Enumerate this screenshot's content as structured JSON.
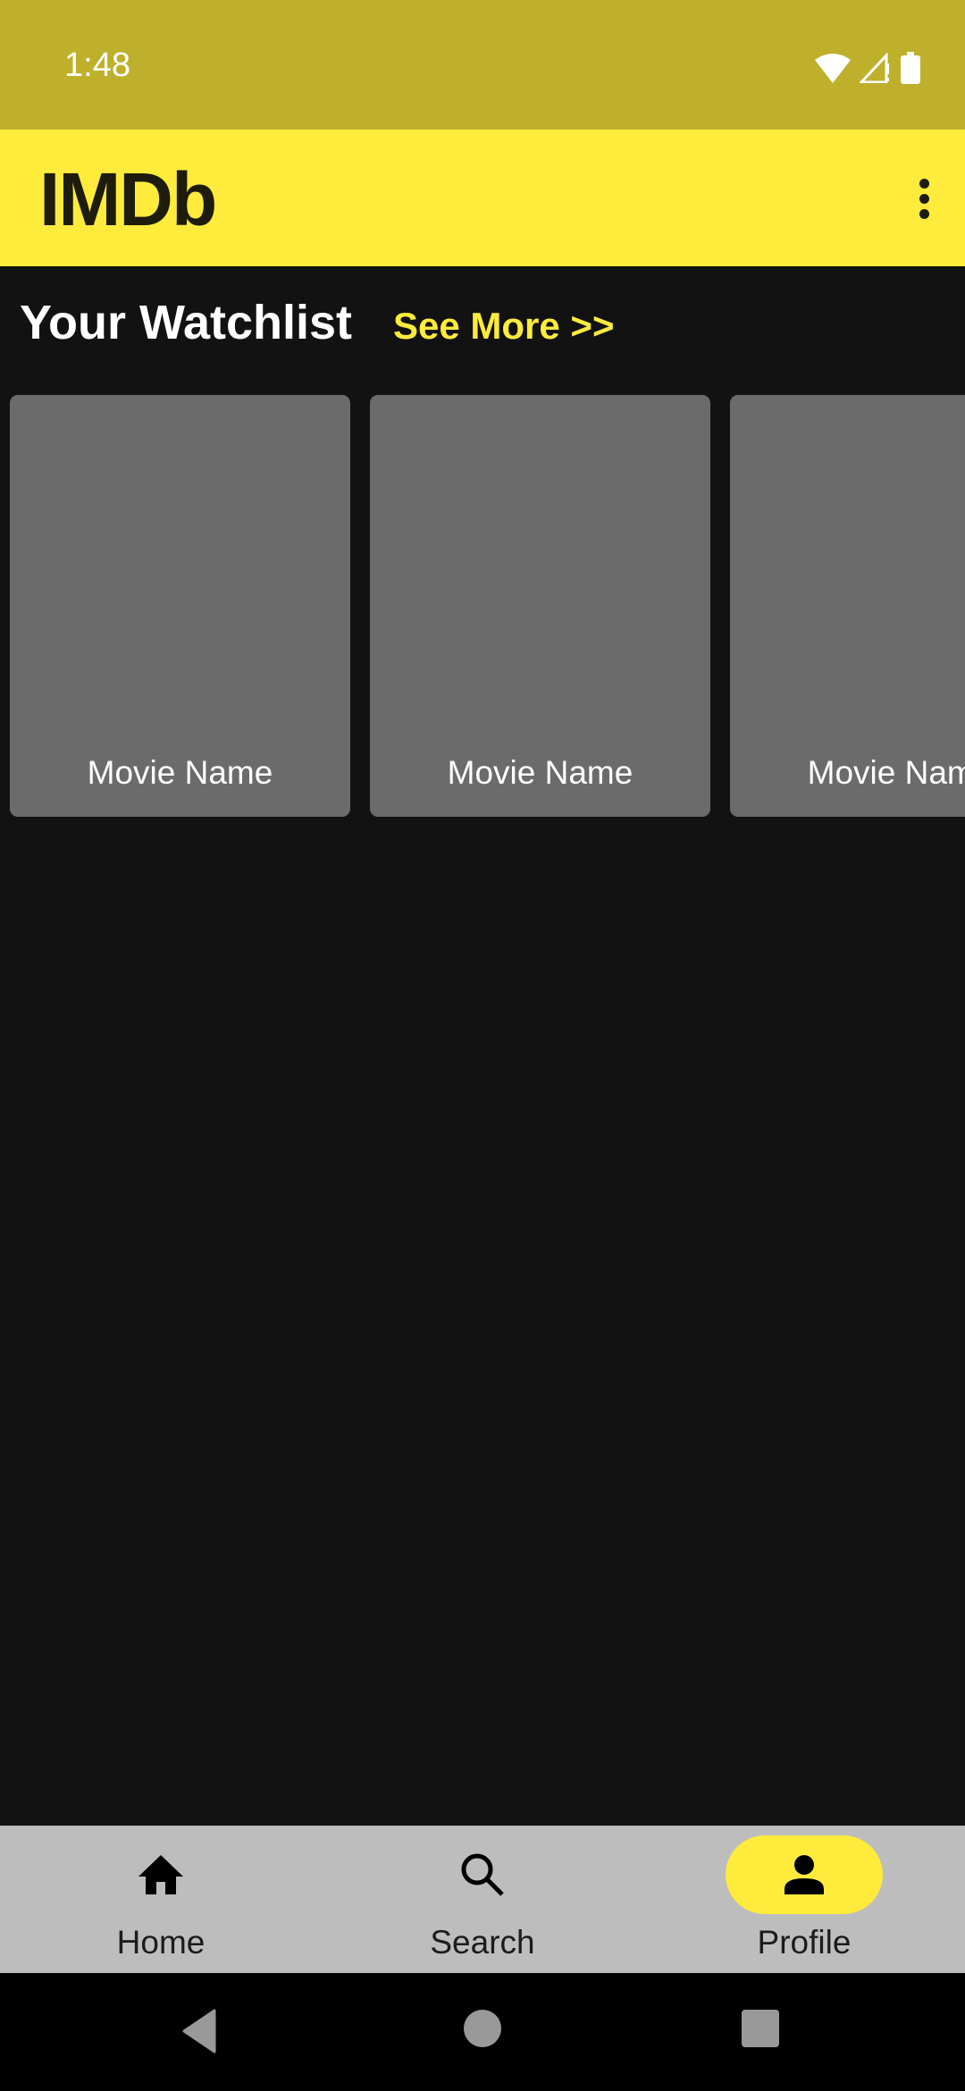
{
  "status_bar": {
    "time": "1:48",
    "icons": [
      "wifi-icon",
      "signal-icon",
      "battery-icon"
    ]
  },
  "app_bar": {
    "title": "IMDb",
    "overflow_icon": "more-vert-icon"
  },
  "watchlist": {
    "title": "Your Watchlist",
    "see_more_label": "See More >>",
    "items": [
      {
        "name": "Movie Name"
      },
      {
        "name": "Movie Name"
      },
      {
        "name": "Movie Name"
      }
    ]
  },
  "bottom_nav": {
    "items": [
      {
        "label": "Home",
        "icon": "home-icon",
        "active": false
      },
      {
        "label": "Search",
        "icon": "search-icon",
        "active": false
      },
      {
        "label": "Profile",
        "icon": "person-icon",
        "active": true
      }
    ]
  },
  "system_nav": {
    "buttons": [
      "back-icon",
      "home-circle-icon",
      "recents-icon"
    ]
  },
  "colors": {
    "accent": "#ffeb3b",
    "status_bar": "#bfb02c",
    "background": "#121212",
    "card": "#6b6b6b",
    "nav_bar": "#bdbdbd"
  }
}
